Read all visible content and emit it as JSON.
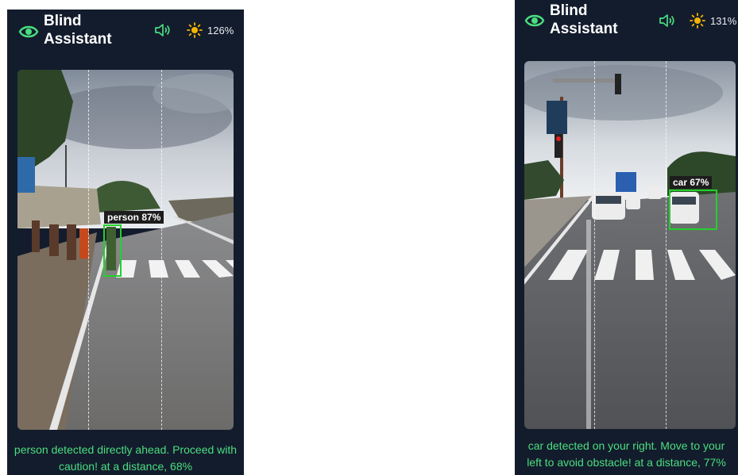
{
  "app": {
    "title_line1": "Blind",
    "title_line2": "Assistant"
  },
  "colors": {
    "background": "#131c2c",
    "accent_green": "#4ade80",
    "sun_yellow": "#f5b400",
    "bbox_green": "#22d12a"
  },
  "screens": [
    {
      "brightness": "126%",
      "detection": {
        "label": "person 87%"
      },
      "message": "person detected directly ahead. Proceed with caution! at a distance, 68%"
    },
    {
      "brightness": "131%",
      "detection": {
        "label": "car 67%"
      },
      "message": "car detected on your right. Move to your left to avoid obstacle! at a distance, 77%"
    }
  ]
}
